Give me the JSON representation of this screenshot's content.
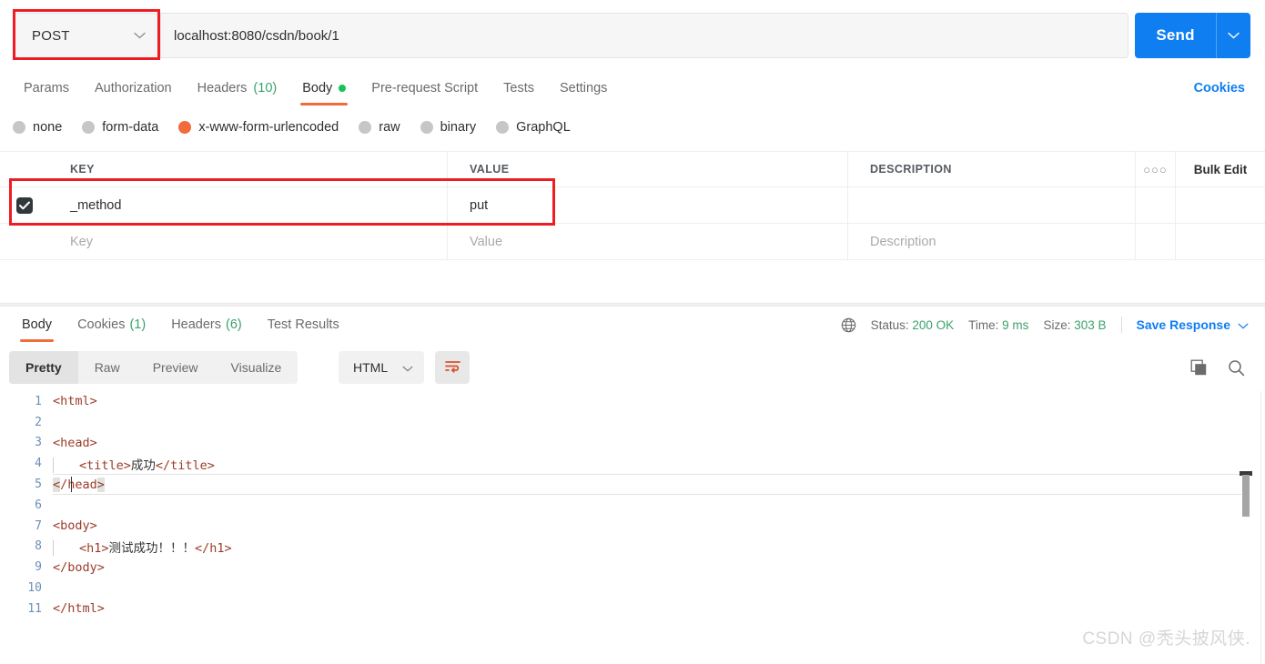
{
  "request": {
    "method": "POST",
    "url": "localhost:8080/csdn/book/1",
    "send_label": "Send",
    "tabs": [
      {
        "label": "Params",
        "count": "",
        "active": false
      },
      {
        "label": "Authorization",
        "count": "",
        "active": false
      },
      {
        "label": "Headers",
        "count": "(10)",
        "active": false
      },
      {
        "label": "Body",
        "count": "",
        "active": true
      },
      {
        "label": "Pre-request Script",
        "count": "",
        "active": false
      },
      {
        "label": "Tests",
        "count": "",
        "active": false
      },
      {
        "label": "Settings",
        "count": "",
        "active": false
      }
    ],
    "cookies_link": "Cookies",
    "body_modes": [
      {
        "label": "none",
        "selected": false
      },
      {
        "label": "form-data",
        "selected": false
      },
      {
        "label": "x-www-form-urlencoded",
        "selected": true
      },
      {
        "label": "raw",
        "selected": false
      },
      {
        "label": "binary",
        "selected": false
      },
      {
        "label": "GraphQL",
        "selected": false
      }
    ],
    "table": {
      "headers": {
        "key": "KEY",
        "value": "VALUE",
        "description": "DESCRIPTION"
      },
      "dots": "●●●",
      "bulk_edit": "Bulk Edit",
      "rows": [
        {
          "checked": true,
          "key": "_method",
          "value": "put",
          "description": ""
        }
      ],
      "placeholders": {
        "key": "Key",
        "value": "Value",
        "description": "Description"
      }
    }
  },
  "response": {
    "tabs": [
      {
        "label": "Body",
        "count": "",
        "active": true
      },
      {
        "label": "Cookies",
        "count": "(1)",
        "active": false
      },
      {
        "label": "Headers",
        "count": "(6)",
        "active": false
      },
      {
        "label": "Test Results",
        "count": "",
        "active": false
      }
    ],
    "status_label": "Status:",
    "status_value": "200 OK",
    "time_label": "Time:",
    "time_value": "9 ms",
    "size_label": "Size:",
    "size_value": "303 B",
    "save_response": "Save Response",
    "view_modes": [
      {
        "label": "Pretty",
        "active": true
      },
      {
        "label": "Raw",
        "active": false
      },
      {
        "label": "Preview",
        "active": false
      },
      {
        "label": "Visualize",
        "active": false
      }
    ],
    "format": "HTML",
    "code_lines": [
      {
        "n": "1",
        "indent": 0,
        "segments": [
          {
            "t": "<html>",
            "c": "tag"
          }
        ]
      },
      {
        "n": "2",
        "indent": 0,
        "segments": []
      },
      {
        "n": "3",
        "indent": 0,
        "segments": [
          {
            "t": "<head>",
            "c": "tag"
          }
        ]
      },
      {
        "n": "4",
        "indent": 1,
        "segments": [
          {
            "t": "<title>",
            "c": "tag"
          },
          {
            "t": "成功",
            "c": "txt"
          },
          {
            "t": "</title>",
            "c": "tag"
          }
        ]
      },
      {
        "n": "5",
        "indent": 0,
        "active": true,
        "segments": [
          {
            "t": "<",
            "c": "brk"
          },
          {
            "t": "/head",
            "c": "tag"
          },
          {
            "t": ">",
            "c": "brk"
          }
        ]
      },
      {
        "n": "6",
        "indent": 0,
        "segments": []
      },
      {
        "n": "7",
        "indent": 0,
        "segments": [
          {
            "t": "<body>",
            "c": "tag"
          }
        ]
      },
      {
        "n": "8",
        "indent": 1,
        "segments": [
          {
            "t": "<h1>",
            "c": "tag"
          },
          {
            "t": "测试成功！！！",
            "c": "txt"
          },
          {
            "t": "</h1>",
            "c": "tag"
          }
        ]
      },
      {
        "n": "9",
        "indent": 0,
        "segments": [
          {
            "t": "</body>",
            "c": "tag"
          }
        ]
      },
      {
        "n": "10",
        "indent": 0,
        "segments": []
      },
      {
        "n": "11",
        "indent": 0,
        "segments": [
          {
            "t": "</html>",
            "c": "tag"
          }
        ]
      }
    ]
  },
  "watermark": "CSDN @秃头披风侠.",
  "colors": {
    "accent_blue": "#0f7ef1",
    "accent_orange": "#f26b3a",
    "success_green": "#3aa26b",
    "highlight_red": "#ee1d24",
    "tag_color": "#9c3b28"
  }
}
